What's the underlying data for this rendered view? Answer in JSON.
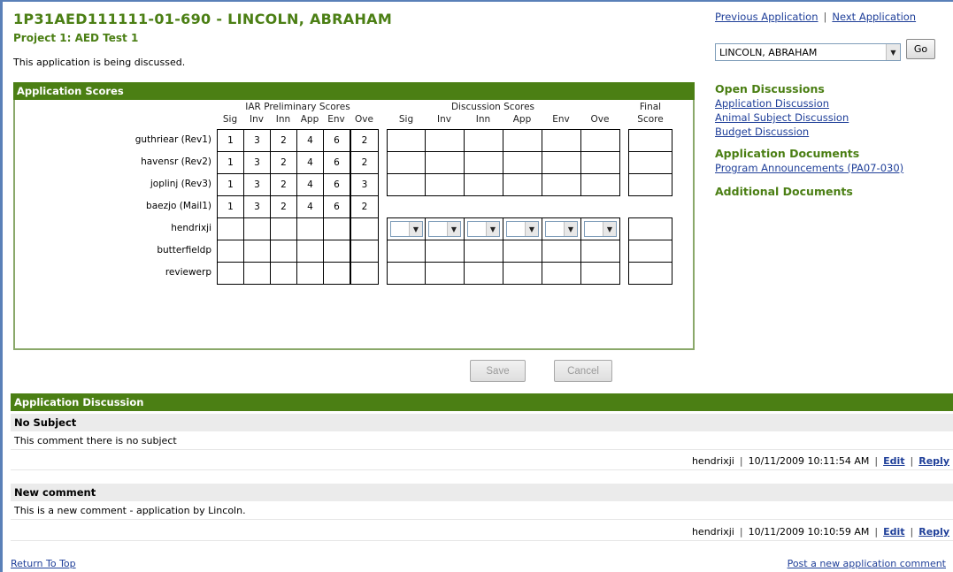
{
  "header": {
    "app_title": "1P31AED111111-01-690 - LINCOLN, ABRAHAM",
    "project_title": "Project 1: AED Test 1",
    "status": "This application is being discussed."
  },
  "nav": {
    "previous": "Previous Application",
    "separator": "|",
    "next": "Next Application",
    "selected_applicant": "LINCOLN, ABRAHAM",
    "go_label": "Go"
  },
  "scores": {
    "title": "Application Scores",
    "iar_header": "IAR Preliminary Scores",
    "discussion_header": "Discussion Scores",
    "final_header_1": "Final",
    "final_header_2": "Score",
    "columns": [
      "Sig",
      "Inv",
      "Inn",
      "App",
      "Env",
      "Ove"
    ],
    "rows": [
      {
        "name": "guthriear (Rev1)",
        "iar": [
          "1",
          "3",
          "2",
          "4",
          "6",
          "2"
        ],
        "disc": "cells"
      },
      {
        "name": "havensr (Rev2)",
        "iar": [
          "1",
          "3",
          "2",
          "4",
          "6",
          "2"
        ],
        "disc": "cells"
      },
      {
        "name": "joplinj (Rev3)",
        "iar": [
          "1",
          "3",
          "2",
          "4",
          "6",
          "3"
        ],
        "disc": "cells"
      },
      {
        "name": "baezjo (Mail1)",
        "iar": [
          "1",
          "3",
          "2",
          "4",
          "6",
          "2"
        ],
        "disc": "none"
      },
      {
        "name": "hendrixji",
        "iar": [
          "",
          "",
          "",
          "",
          "",
          ""
        ],
        "disc": "selects"
      },
      {
        "name": "butterfieldp",
        "iar": [
          "",
          "",
          "",
          "",
          "",
          ""
        ],
        "disc": "cells"
      },
      {
        "name": "reviewerp",
        "iar": [
          "",
          "",
          "",
          "",
          "",
          ""
        ],
        "disc": "cells"
      }
    ],
    "save_label": "Save",
    "cancel_label": "Cancel"
  },
  "sidebar": {
    "open_discussions": "Open Discussions",
    "discussion_links": [
      "Application Discussion",
      "Animal Subject Discussion",
      "Budget Discussion"
    ],
    "application_documents": "Application Documents",
    "document_links": [
      "Program Announcements (PA07-030)"
    ],
    "additional_documents": "Additional Documents"
  },
  "discussion": {
    "title": "Application Discussion",
    "comments": [
      {
        "subject": "No Subject",
        "body": "This comment there is no subject",
        "author": "hendrixji",
        "timestamp": "10/11/2009 10:11:54 AM",
        "edit": "Edit",
        "reply": "Reply"
      },
      {
        "subject": "New comment",
        "body": "This is a new comment - application by Lincoln.",
        "author": "hendrixji",
        "timestamp": "10/11/2009 10:10:59 AM",
        "edit": "Edit",
        "reply": "Reply"
      }
    ]
  },
  "footer": {
    "return_top": "Return To Top",
    "post_comment": "Post a new application comment"
  }
}
